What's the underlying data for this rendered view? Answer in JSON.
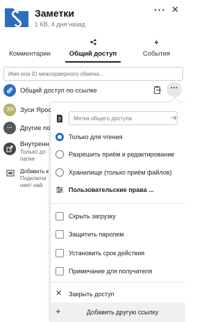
{
  "header": {
    "title": "Заметки",
    "subtitle": "1 КВ, 4 дня назад",
    "more_label": "···",
    "close_label": "✕"
  },
  "tabs": [
    {
      "label": "Комментарии",
      "icon": "comment-icon",
      "active": false
    },
    {
      "label": "Общий доступ",
      "icon": "share-icon",
      "active": true
    },
    {
      "label": "События",
      "icon": "lightning-icon",
      "active": false
    }
  ],
  "search": {
    "placeholder": "Имя или ID межсерверного обмена..."
  },
  "shares": [
    {
      "label": "Общий доступ по ссылке",
      "avatar_color": "#2b6dbf",
      "icon": "link-icon"
    },
    {
      "label": "Зуси Яросл",
      "avatar_text": "ЗЯ",
      "avatar_color": "#b8b26a"
    },
    {
      "label": "Другие по",
      "avatar_color": "#555555",
      "icon": "dots-icon"
    },
    {
      "label": "Внутренн",
      "sub1": "Только дл",
      "sub2": "папке",
      "avatar_color": "#444444",
      "icon": "external-icon"
    },
    {
      "label": "Добавить к",
      "sub1": "Подключи",
      "sub2": "ният най",
      "icon": "server-icon"
    }
  ],
  "menu": {
    "label_placeholder": "Метка общего доступа",
    "read_only": "Только для чтения",
    "allow_edit": "Разрешить приём и редактирование",
    "file_drop": "Хранилище (только приём файлов)",
    "custom_rights": "Пользовательские права ...",
    "hide_download": "Скрыть загрузку",
    "password": "Защитить паролем",
    "expiry": "Установить срок действия",
    "note": "Примечание для получателя",
    "unshare": "Закрыть доступ",
    "add_link": "Добавить другую ссылку"
  },
  "colors": {
    "accent": "#1f6fc5",
    "folder": "#2b6dbf"
  }
}
